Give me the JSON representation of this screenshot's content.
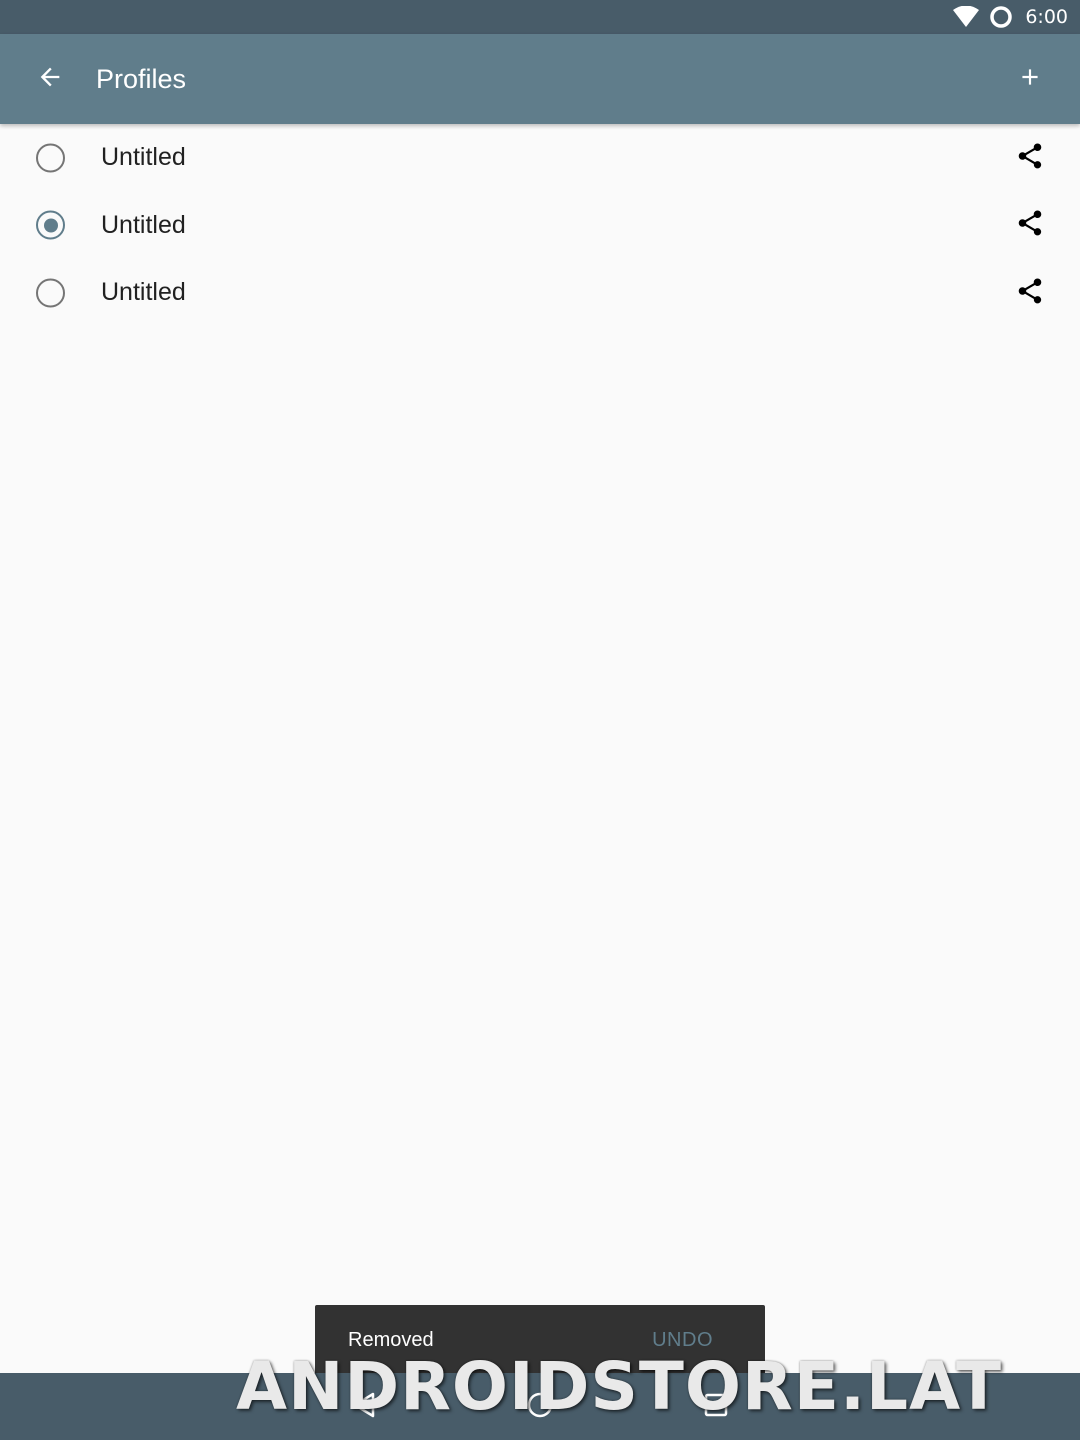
{
  "status_bar": {
    "time": "6:00",
    "icons": [
      "wifi-icon",
      "ring-icon"
    ]
  },
  "app_bar": {
    "title": "Profiles",
    "back_icon": "arrow-back-icon",
    "add_icon": "plus-icon"
  },
  "profiles": [
    {
      "label": "Untitled",
      "selected": false,
      "action_icon": "share-icon"
    },
    {
      "label": "Untitled",
      "selected": true,
      "action_icon": "share-icon"
    },
    {
      "label": "Untitled",
      "selected": false,
      "action_icon": "share-icon"
    }
  ],
  "snackbar": {
    "message": "Removed",
    "action": "UNDO"
  },
  "nav_bar": {
    "icons": [
      "back-triangle-icon",
      "home-circle-icon",
      "recents-square-icon"
    ]
  },
  "watermark": "ANDROIDSTORE.LAT",
  "colors": {
    "primary": "#607d8b",
    "primary_dark": "#485c69",
    "background": "#fafafa",
    "snackbar": "#323232"
  }
}
